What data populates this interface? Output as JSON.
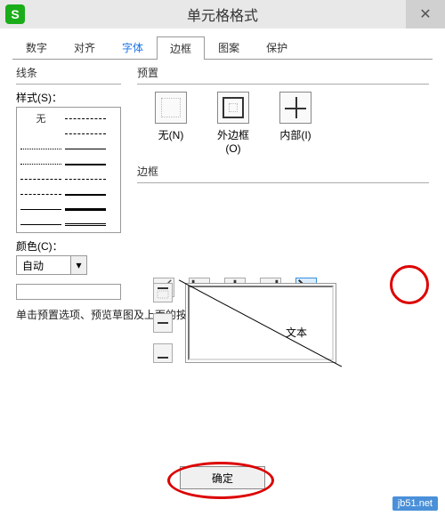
{
  "title": "单元格格式",
  "app_icon_letter": "S",
  "close_glyph": "✕",
  "tabs": {
    "number": "数字",
    "align": "对齐",
    "font": "字体",
    "border": "边框",
    "pattern": "图案",
    "protect": "保护"
  },
  "line": {
    "group": "线条",
    "style_label": "样式(S)：",
    "none_label": "无",
    "color_label": "颜色(C)：",
    "color_value": "自动",
    "combo_arrow": "▾"
  },
  "preset": {
    "group": "预置",
    "none": "无(N)",
    "outer": "外边框(O)",
    "inner": "内部(I)"
  },
  "border": {
    "group": "边框",
    "sample": "文本"
  },
  "hint": "单击预置选项、预览草图及上面的按钮可以添加边框样式。",
  "ok": "确定",
  "watermark": "jb51.net"
}
